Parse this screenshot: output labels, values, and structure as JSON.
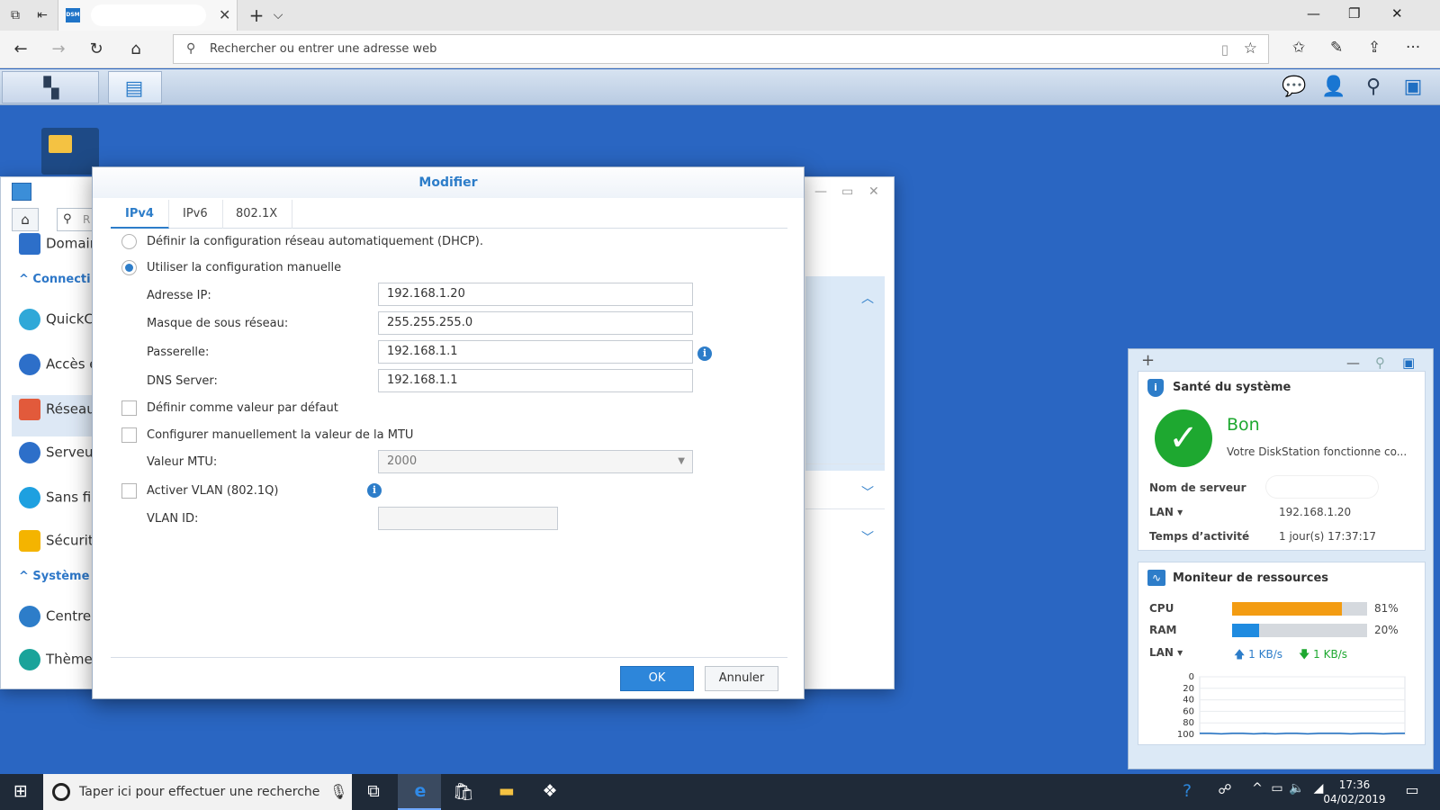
{
  "browser": {
    "tab_close": "✕",
    "tab_new": "+",
    "tab_menu": "⌵",
    "address_placeholder": "Rechercher ou entrer une adresse web",
    "win_min": "—",
    "win_max": "❐",
    "win_close": "✕"
  },
  "control_panel": {
    "search_placeholder": "R",
    "items": [
      {
        "label": "Domain",
        "color": "#2d6fc9"
      },
      {
        "label": "QuickC",
        "color": "#2fa8d8"
      },
      {
        "label": "Accès e",
        "color": "#2d6fc9"
      },
      {
        "label": "Réseau",
        "color": "#e25a3b"
      },
      {
        "label": "Serveur",
        "color": "#2d6fc9"
      },
      {
        "label": "Sans fil",
        "color": "#1ea0e0"
      },
      {
        "label": "Sécurité",
        "color": "#f4b400"
      },
      {
        "label": "Centre",
        "color": "#2d7dc9"
      },
      {
        "label": "Thème",
        "color": "#1aa39a"
      }
    ],
    "sections": [
      "Connecti",
      "Système"
    ]
  },
  "modal": {
    "title": "Modifier",
    "tabs": [
      "IPv4",
      "IPv6",
      "802.1X"
    ],
    "active_tab": "IPv4",
    "dhcp_label": "Définir la configuration réseau automatiquement (DHCP).",
    "manual_label": "Utiliser la configuration manuelle",
    "ip_label": "Adresse IP:",
    "ip_value": "192.168.1.20",
    "mask_label": "Masque de sous réseau:",
    "mask_value": "255.255.255.0",
    "gateway_label": "Passerelle:",
    "gateway_value": "192.168.1.1",
    "dns_label": "DNS Server:",
    "dns_value": "192.168.1.1",
    "default_label": "Définir comme valeur par défaut",
    "mtu_manual_label": "Configurer manuellement la valeur de la MTU",
    "mtu_label": "Valeur MTU:",
    "mtu_value": "2000",
    "vlan_label": "Activer VLAN (802.1Q)",
    "vlan_id_label": "VLAN ID:",
    "vlan_id_value": "",
    "ok": "OK",
    "cancel": "Annuler"
  },
  "widget": {
    "health_title": "Santé du système",
    "status": "Bon",
    "status_desc": "Votre DiskStation fonctionne co...",
    "server_name_label": "Nom de serveur",
    "lan_label": "LAN ▾",
    "lan_value": "192.168.1.20",
    "uptime_label": "Temps d’activité",
    "uptime_value": "1 jour(s) 17:37:17",
    "monitor_title": "Moniteur de ressources",
    "cpu_label": "CPU",
    "cpu_percent": 81,
    "cpu_text": "81%",
    "ram_label": "RAM",
    "ram_percent": 20,
    "ram_text": "20%",
    "net_label": "LAN ▾",
    "upload": "1 KB/s",
    "download": "1 KB/s",
    "chart_ticks": [
      "100",
      "80",
      "60",
      "40",
      "20",
      "0"
    ],
    "cpu_color": "#f39c12",
    "ram_color": "#1f8be0",
    "good_color": "#1ea830"
  },
  "taskbar": {
    "search_placeholder": "Taper ici pour effectuer une recherche",
    "time": "17:36",
    "date": "04/02/2019"
  },
  "chart_data": {
    "type": "line",
    "title": "",
    "ylim": [
      0,
      100
    ],
    "yticks": [
      0,
      20,
      40,
      60,
      80,
      100
    ],
    "series": [
      {
        "name": "",
        "values": [
          2,
          2,
          1,
          2,
          2,
          1,
          2,
          1,
          2,
          2,
          1,
          2,
          2,
          2,
          1,
          2,
          2,
          1,
          2,
          2
        ]
      }
    ]
  }
}
